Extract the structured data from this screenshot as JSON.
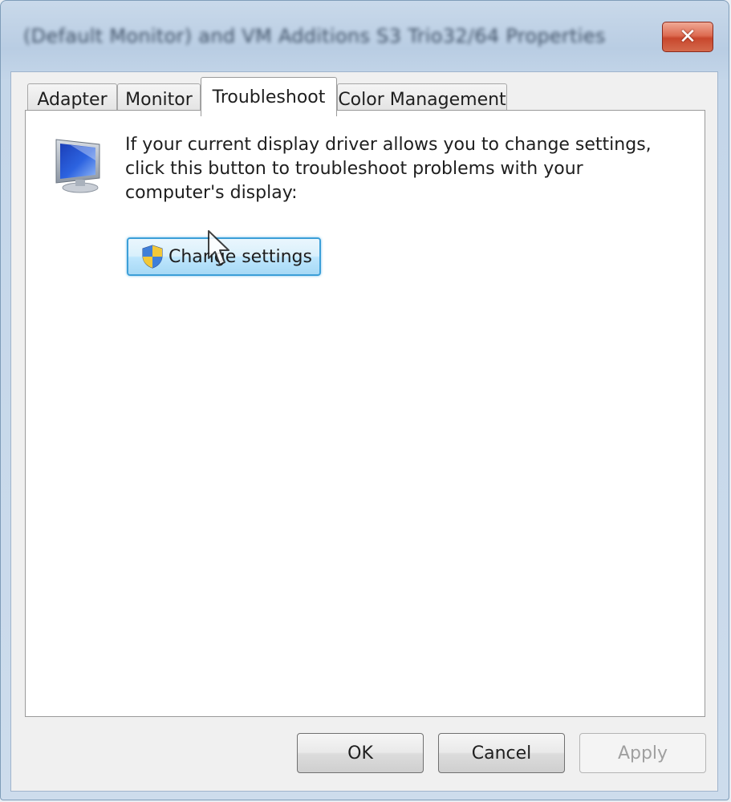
{
  "window": {
    "title": "(Default Monitor) and VM Additions S3 Trio32/64 Properties",
    "close_glyph": "✕"
  },
  "tabs": [
    {
      "label": "Adapter",
      "active": false
    },
    {
      "label": "Monitor",
      "active": false
    },
    {
      "label": "Troubleshoot",
      "active": true
    },
    {
      "label": "Color Management",
      "active": false
    }
  ],
  "troubleshoot": {
    "description": "If your current display driver allows you to change settings, click this button to troubleshoot problems with your computer's display:",
    "change_button_label": "Change settings",
    "icons": {
      "monitor": "monitor-icon",
      "shield": "uac-shield-icon"
    }
  },
  "footer": {
    "ok_label": "OK",
    "cancel_label": "Cancel",
    "apply_label": "Apply",
    "apply_enabled": false
  },
  "colors": {
    "accent": "#3c9fd8",
    "close": "#c8472d"
  }
}
